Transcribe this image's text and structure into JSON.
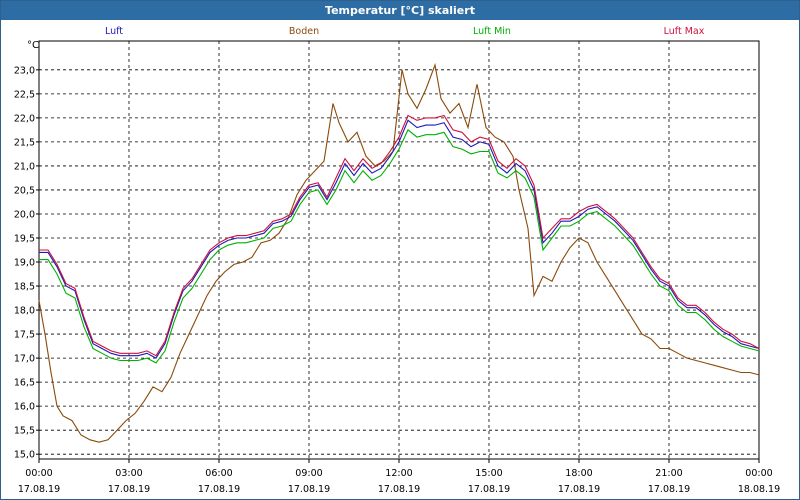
{
  "window": {
    "title": "Temperatur [°C] skaliert"
  },
  "chart_data": {
    "type": "line",
    "title": "Temperatur [°C] skaliert",
    "ylabel": "°C",
    "xlabel": "",
    "ylim": [
      14.9,
      23.6
    ],
    "xlim": [
      0,
      24
    ],
    "grid": true,
    "legend": "top",
    "yticks": [
      15.0,
      15.5,
      16.0,
      16.5,
      17.0,
      17.5,
      18.0,
      18.5,
      19.0,
      19.5,
      20.0,
      20.5,
      21.0,
      21.5,
      22.0,
      22.5,
      23.0
    ],
    "ytick_labels": [
      "15,0",
      "15,5",
      "16,0",
      "16,5",
      "17,0",
      "17,5",
      "18,0",
      "18,5",
      "19,0",
      "19,5",
      "20,0",
      "20,5",
      "21,0",
      "21,5",
      "22,0",
      "22,5",
      "23,0"
    ],
    "xticks": [
      0,
      3,
      6,
      9,
      12,
      15,
      18,
      21,
      24
    ],
    "xtick_times": [
      "00:00",
      "03:00",
      "06:00",
      "09:00",
      "12:00",
      "15:00",
      "18:00",
      "21:00",
      "00:00"
    ],
    "xtick_dates": [
      "17.08.19",
      "17.08.19",
      "17.08.19",
      "17.08.19",
      "17.08.19",
      "17.08.19",
      "17.08.19",
      "17.08.19",
      "18.08.19"
    ],
    "series": [
      {
        "name": "Luft",
        "color": "#1a1ab8",
        "x": [
          0,
          0.3,
          0.6,
          0.9,
          1.2,
          1.5,
          1.8,
          2.1,
          2.4,
          2.7,
          3.0,
          3.3,
          3.6,
          3.9,
          4.2,
          4.5,
          4.8,
          5.1,
          5.4,
          5.7,
          6.0,
          6.3,
          6.6,
          6.9,
          7.2,
          7.5,
          7.8,
          8.1,
          8.4,
          8.7,
          9.0,
          9.3,
          9.6,
          9.9,
          10.2,
          10.5,
          10.8,
          11.1,
          11.4,
          11.7,
          12.0,
          12.3,
          12.6,
          12.9,
          13.2,
          13.5,
          13.8,
          14.1,
          14.4,
          14.7,
          15.0,
          15.3,
          15.6,
          15.9,
          16.2,
          16.5,
          16.8,
          17.1,
          17.4,
          17.7,
          18.0,
          18.3,
          18.6,
          18.9,
          19.2,
          19.5,
          19.8,
          20.1,
          20.4,
          20.7,
          21.0,
          21.3,
          21.6,
          21.9,
          22.2,
          22.5,
          22.8,
          23.1,
          23.4,
          23.7,
          24.0
        ],
        "values": [
          19.2,
          19.2,
          18.9,
          18.5,
          18.4,
          17.8,
          17.3,
          17.2,
          17.1,
          17.05,
          17.05,
          17.05,
          17.1,
          17.0,
          17.3,
          17.9,
          18.4,
          18.6,
          18.9,
          19.2,
          19.35,
          19.45,
          19.5,
          19.5,
          19.55,
          19.6,
          19.8,
          19.85,
          19.95,
          20.3,
          20.55,
          20.6,
          20.3,
          20.65,
          21.05,
          20.8,
          21.05,
          20.85,
          20.95,
          21.2,
          21.5,
          21.95,
          21.8,
          21.85,
          21.85,
          21.9,
          21.6,
          21.55,
          21.4,
          21.5,
          21.45,
          21.0,
          20.85,
          21.05,
          20.9,
          20.5,
          19.4,
          19.6,
          19.85,
          19.85,
          19.95,
          20.1,
          20.15,
          20.0,
          19.85,
          19.65,
          19.45,
          19.15,
          18.85,
          18.6,
          18.5,
          18.2,
          18.05,
          18.05,
          17.9,
          17.7,
          17.55,
          17.45,
          17.3,
          17.25,
          17.2
        ]
      },
      {
        "name": "Boden",
        "color": "#8b4a0a",
        "x": [
          0,
          0.2,
          0.4,
          0.6,
          0.8,
          1.1,
          1.4,
          1.7,
          2.0,
          2.3,
          2.6,
          2.9,
          3.2,
          3.5,
          3.8,
          4.1,
          4.4,
          4.7,
          5.0,
          5.3,
          5.6,
          5.9,
          6.2,
          6.5,
          6.8,
          7.1,
          7.4,
          7.7,
          8.0,
          8.3,
          8.6,
          8.9,
          9.2,
          9.5,
          9.8,
          10.0,
          10.3,
          10.6,
          10.9,
          11.2,
          11.5,
          11.8,
          12.1,
          12.3,
          12.6,
          12.9,
          13.2,
          13.4,
          13.7,
          14.0,
          14.3,
          14.6,
          14.9,
          15.2,
          15.5,
          15.8,
          16.0,
          16.3,
          16.5,
          16.8,
          17.1,
          17.4,
          17.7,
          18.0,
          18.3,
          18.6,
          18.9,
          19.2,
          19.5,
          19.8,
          20.1,
          20.4,
          20.7,
          21.0,
          21.3,
          21.6,
          21.9,
          22.2,
          22.5,
          22.8,
          23.1,
          23.4,
          23.7,
          24.0
        ],
        "values": [
          18.2,
          17.5,
          16.7,
          16.0,
          15.8,
          15.7,
          15.4,
          15.3,
          15.25,
          15.3,
          15.5,
          15.7,
          15.85,
          16.1,
          16.4,
          16.3,
          16.6,
          17.1,
          17.5,
          17.9,
          18.3,
          18.6,
          18.8,
          18.95,
          19.0,
          19.1,
          19.4,
          19.45,
          19.6,
          19.9,
          20.4,
          20.7,
          20.9,
          21.1,
          22.3,
          21.9,
          21.5,
          21.7,
          21.2,
          21.0,
          21.1,
          21.3,
          23.0,
          22.5,
          22.2,
          22.6,
          23.1,
          22.4,
          22.1,
          22.3,
          21.8,
          22.7,
          21.8,
          21.6,
          21.5,
          21.2,
          20.5,
          19.7,
          18.3,
          18.7,
          18.6,
          19.0,
          19.3,
          19.5,
          19.4,
          19.0,
          18.7,
          18.4,
          18.1,
          17.8,
          17.5,
          17.4,
          17.2,
          17.2,
          17.1,
          17.0,
          16.95,
          16.9,
          16.85,
          16.8,
          16.75,
          16.7,
          16.7,
          16.65
        ]
      },
      {
        "name": "Luft Min",
        "color": "#00b000",
        "x": [
          0,
          0.3,
          0.6,
          0.9,
          1.2,
          1.5,
          1.8,
          2.1,
          2.4,
          2.7,
          3.0,
          3.3,
          3.6,
          3.9,
          4.2,
          4.5,
          4.8,
          5.1,
          5.4,
          5.7,
          6.0,
          6.3,
          6.6,
          6.9,
          7.2,
          7.5,
          7.8,
          8.1,
          8.4,
          8.7,
          9.0,
          9.3,
          9.6,
          9.9,
          10.2,
          10.5,
          10.8,
          11.1,
          11.4,
          11.7,
          12.0,
          12.3,
          12.6,
          12.9,
          13.2,
          13.5,
          13.8,
          14.1,
          14.4,
          14.7,
          15.0,
          15.3,
          15.6,
          15.9,
          16.2,
          16.5,
          16.8,
          17.1,
          17.4,
          17.7,
          18.0,
          18.3,
          18.6,
          18.9,
          19.2,
          19.5,
          19.8,
          20.1,
          20.4,
          20.7,
          21.0,
          21.3,
          21.6,
          21.9,
          22.2,
          22.5,
          22.8,
          23.1,
          23.4,
          23.7,
          24.0
        ],
        "values": [
          19.05,
          19.05,
          18.75,
          18.35,
          18.25,
          17.65,
          17.2,
          17.1,
          17.0,
          16.95,
          16.95,
          16.95,
          17.0,
          16.9,
          17.15,
          17.75,
          18.25,
          18.45,
          18.75,
          19.05,
          19.25,
          19.35,
          19.4,
          19.4,
          19.45,
          19.5,
          19.7,
          19.75,
          19.85,
          20.2,
          20.45,
          20.5,
          20.2,
          20.5,
          20.9,
          20.65,
          20.9,
          20.7,
          20.8,
          21.05,
          21.35,
          21.75,
          21.6,
          21.65,
          21.65,
          21.7,
          21.4,
          21.35,
          21.25,
          21.3,
          21.3,
          20.85,
          20.75,
          20.9,
          20.75,
          20.35,
          19.25,
          19.5,
          19.75,
          19.75,
          19.85,
          20.0,
          20.05,
          19.9,
          19.75,
          19.55,
          19.35,
          19.05,
          18.75,
          18.5,
          18.4,
          18.1,
          17.95,
          17.95,
          17.8,
          17.6,
          17.45,
          17.35,
          17.25,
          17.2,
          17.15
        ]
      },
      {
        "name": "Luft Max",
        "color": "#d0103a",
        "x": [
          0,
          0.3,
          0.6,
          0.9,
          1.2,
          1.5,
          1.8,
          2.1,
          2.4,
          2.7,
          3.0,
          3.3,
          3.6,
          3.9,
          4.2,
          4.5,
          4.8,
          5.1,
          5.4,
          5.7,
          6.0,
          6.3,
          6.6,
          6.9,
          7.2,
          7.5,
          7.8,
          8.1,
          8.4,
          8.7,
          9.0,
          9.3,
          9.6,
          9.9,
          10.2,
          10.5,
          10.8,
          11.1,
          11.4,
          11.7,
          12.0,
          12.3,
          12.6,
          12.9,
          13.2,
          13.5,
          13.8,
          14.1,
          14.4,
          14.7,
          15.0,
          15.3,
          15.6,
          15.9,
          16.2,
          16.5,
          16.8,
          17.1,
          17.4,
          17.7,
          18.0,
          18.3,
          18.6,
          18.9,
          19.2,
          19.5,
          19.8,
          20.1,
          20.4,
          20.7,
          21.0,
          21.3,
          21.6,
          21.9,
          22.2,
          22.5,
          22.8,
          23.1,
          23.4,
          23.7,
          24.0
        ],
        "values": [
          19.25,
          19.25,
          18.95,
          18.55,
          18.45,
          17.85,
          17.35,
          17.25,
          17.15,
          17.1,
          17.1,
          17.1,
          17.15,
          17.05,
          17.35,
          17.95,
          18.45,
          18.65,
          18.95,
          19.25,
          19.4,
          19.5,
          19.55,
          19.55,
          19.6,
          19.65,
          19.85,
          19.9,
          20.0,
          20.35,
          20.6,
          20.65,
          20.35,
          20.75,
          21.15,
          20.9,
          21.15,
          20.95,
          21.05,
          21.3,
          21.6,
          22.05,
          21.95,
          22.0,
          22.0,
          22.05,
          21.75,
          21.7,
          21.5,
          21.6,
          21.55,
          21.1,
          20.95,
          21.15,
          21.0,
          20.6,
          19.5,
          19.7,
          19.9,
          19.9,
          20.05,
          20.15,
          20.2,
          20.05,
          19.9,
          19.7,
          19.5,
          19.2,
          18.9,
          18.65,
          18.55,
          18.25,
          18.1,
          18.1,
          17.95,
          17.75,
          17.6,
          17.5,
          17.35,
          17.3,
          17.2
        ]
      }
    ]
  }
}
